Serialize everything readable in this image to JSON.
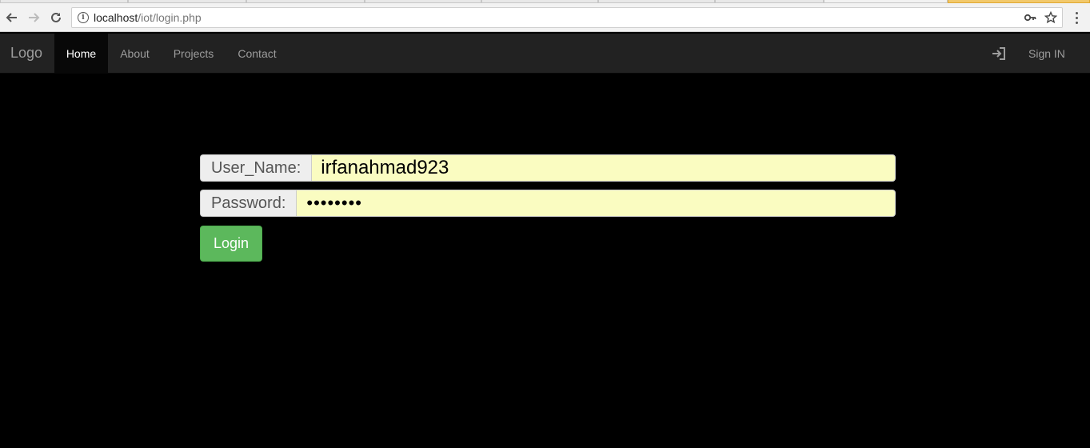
{
  "browser": {
    "url_host": "localhost",
    "url_path": "/iot/login.php",
    "icons": [
      "back-icon",
      "forward-icon",
      "reload-icon",
      "info-icon",
      "key-icon",
      "star-icon",
      "menu-icon"
    ]
  },
  "navbar": {
    "brand": "Logo",
    "items": [
      {
        "label": "Home",
        "active": true
      },
      {
        "label": "About",
        "active": false
      },
      {
        "label": "Projects",
        "active": false
      },
      {
        "label": "Contact",
        "active": false
      }
    ],
    "signin_label": "Sign IN",
    "signin_icon": "log-in-icon"
  },
  "form": {
    "username_label": "User_Name:",
    "username_value": "irfanahmad923",
    "password_label": "Password:",
    "password_value": "••••••••",
    "login_label": "Login"
  },
  "colors": {
    "navbar_bg": "#222222",
    "page_bg": "#000000",
    "field_bg": "#fafcc1",
    "login_btn": "#5cb85c"
  }
}
